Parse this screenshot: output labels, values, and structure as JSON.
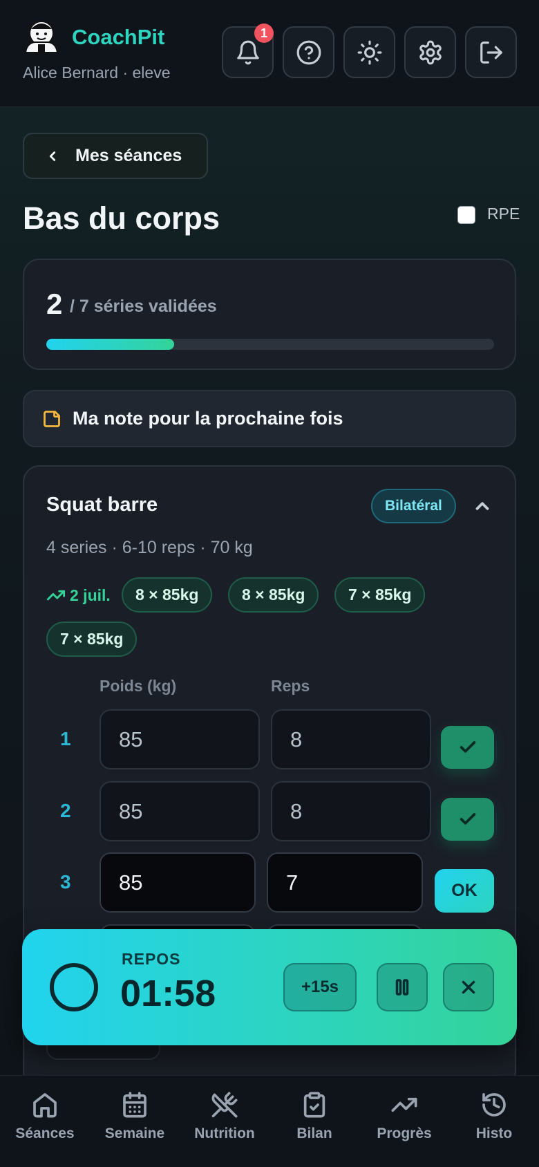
{
  "header": {
    "app_name": "CoachPit",
    "user_line": "Alice Bernard · eleve",
    "notification_count": "1",
    "icons": [
      "bell-icon",
      "help-icon",
      "sun-icon",
      "gear-icon",
      "logout-icon"
    ]
  },
  "nav_back": {
    "label": "Mes séances"
  },
  "page": {
    "title": "Bas du corps",
    "rpe_label": "RPE",
    "rpe_checked": false
  },
  "progress": {
    "done": "2",
    "total_text": "/ 7 séries validées",
    "fraction": 0.2857
  },
  "note": {
    "label": "Ma note pour la prochaine fois"
  },
  "exercise": {
    "name": "Squat barre",
    "tag": "Bilatéral",
    "meta": "4 series · 6-10 reps · 70 kg",
    "history_date": "2 juil.",
    "history": [
      "8 × 85kg",
      "8 × 85kg",
      "7 × 85kg",
      "7 × 85kg"
    ],
    "col_weight": "Poids (kg)",
    "col_reps": "Reps",
    "sets": [
      {
        "num": "1",
        "weight": "85",
        "reps": "8",
        "state": "done"
      },
      {
        "num": "2",
        "weight": "85",
        "reps": "8",
        "state": "done"
      },
      {
        "num": "3",
        "weight": "85",
        "reps": "7",
        "state": "active",
        "action": "OK"
      }
    ]
  },
  "rest_timer": {
    "label": "REPOS",
    "time": "01:58",
    "add_label": "+15s"
  },
  "bottom_nav": {
    "items": [
      {
        "label": "Séances",
        "icon": "home-icon"
      },
      {
        "label": "Semaine",
        "icon": "calendar-icon"
      },
      {
        "label": "Nutrition",
        "icon": "utensils-crossed-icon"
      },
      {
        "label": "Bilan",
        "icon": "clipboard-check-icon"
      },
      {
        "label": "Progrès",
        "icon": "trending-up-icon"
      },
      {
        "label": "Histo",
        "icon": "history-icon"
      }
    ]
  },
  "colors": {
    "accent_teal": "#2dd4bf",
    "accent_cyan": "#22d3ee",
    "success_green": "#34d399",
    "badge_red": "#f2545f",
    "note_yellow": "#f5b83d",
    "background": "#0d1117"
  }
}
